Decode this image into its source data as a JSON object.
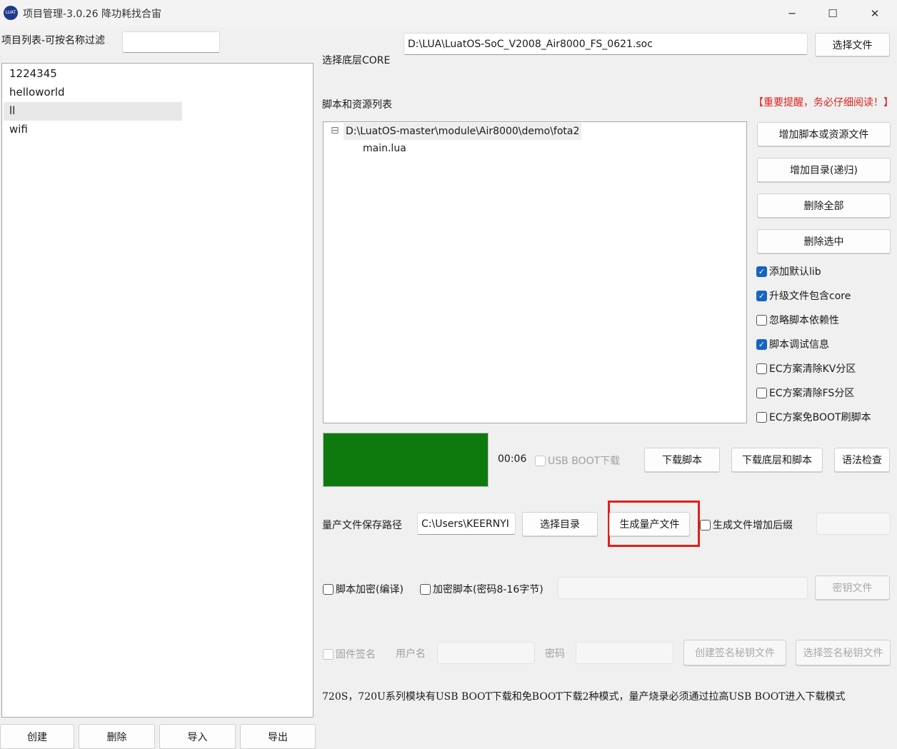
{
  "window": {
    "title": "项目管理-3.0.26 降功耗找合宙",
    "icon_text": "LUAT",
    "controls": {
      "minimize": "─",
      "maximize": "☐",
      "close": "✕"
    }
  },
  "left": {
    "filter_label": "项目列表-可按名称过滤",
    "filter_value": "",
    "projects": [
      "1224345",
      "helloworld",
      "ll",
      "wifi"
    ],
    "selected_index": 2,
    "buttons": {
      "create": "创建",
      "delete": "删除",
      "import": "导入",
      "export": "导出"
    }
  },
  "core": {
    "label": "选择底层CORE",
    "path": "D:\\LUA\\LuatOS-SoC_V2008_Air8000_FS_0621.soc",
    "select_button": "选择文件"
  },
  "scripts": {
    "label": "脚本和资源列表",
    "warning": "【重要提醒，务必仔细阅读！】",
    "tree_root": "D:\\LuatOS-master\\module\\Air8000\\demo\\fota2",
    "tree_child": "main.lua",
    "tree_toggle": "⊟"
  },
  "actions": {
    "add_file": "增加脚本或资源文件",
    "add_dir": "增加目录(递归)",
    "delete_all": "删除全部",
    "delete_selected": "删除选中"
  },
  "options": [
    {
      "label": "添加默认lib",
      "checked": true
    },
    {
      "label": "升级文件包含core",
      "checked": true
    },
    {
      "label": "忽略脚本依赖性",
      "checked": false
    },
    {
      "label": "脚本调试信息",
      "checked": true
    },
    {
      "label": "EC方案清除KV分区",
      "checked": false
    },
    {
      "label": "EC方案清除FS分区",
      "checked": false
    },
    {
      "label": "EC方案免BOOT刷脚本",
      "checked": false
    }
  ],
  "download": {
    "progress_color": "#0e7a0e",
    "progress_fraction": 1.0,
    "timer": "00:06",
    "usb_boot_label": "USB BOOT下载",
    "download_script": "下载脚本",
    "download_core_script": "下载底层和脚本",
    "syntax_check": "语法检查"
  },
  "production": {
    "label": "量产文件保存路径",
    "path": "C:\\Users\\KEERNYI",
    "select_dir": "选择目录",
    "generate": "生成量产文件",
    "suffix_label": "生成文件增加后缀",
    "suffix_value": "",
    "highlight_color": "#e0201a"
  },
  "encrypt": {
    "compile_label": "脚本加密(编译)",
    "password_label": "加密脚本(密码8-16字节)",
    "password_value": "",
    "key_file": "密钥文件"
  },
  "signing": {
    "firmware_sign": "固件签名",
    "username_label": "用户名",
    "password_label": "密码",
    "create_key": "创建签名秘钥文件",
    "select_key": "选择签名秘钥文件"
  },
  "note": "720S，720U系列模块有USB BOOT下载和免BOOT下载2种模式，量产烧录必须通过拉高USB BOOT进入下载模式"
}
